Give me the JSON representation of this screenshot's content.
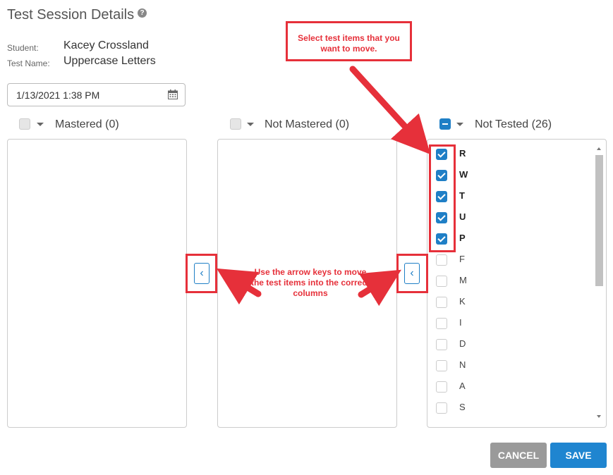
{
  "header": {
    "title": "Test Session Details",
    "help_icon": "?"
  },
  "student": {
    "label": "Student:",
    "value": "Kacey Crossland"
  },
  "test": {
    "label": "Test Name:",
    "value": "Uppercase Letters"
  },
  "date_field": {
    "value": "1/13/2021 1:38 PM",
    "icon": "calendar-icon"
  },
  "columns": {
    "mastered": {
      "title": "Mastered (0)"
    },
    "not_mastered": {
      "title": "Not Mastered (0)"
    },
    "not_tested": {
      "title": "Not Tested (26)"
    }
  },
  "items": [
    {
      "label": "R",
      "checked": true
    },
    {
      "label": "W",
      "checked": true
    },
    {
      "label": "T",
      "checked": true
    },
    {
      "label": "U",
      "checked": true
    },
    {
      "label": "P",
      "checked": true
    },
    {
      "label": "F",
      "checked": false
    },
    {
      "label": "M",
      "checked": false
    },
    {
      "label": "K",
      "checked": false
    },
    {
      "label": "I",
      "checked": false
    },
    {
      "label": "D",
      "checked": false
    },
    {
      "label": "N",
      "checked": false
    },
    {
      "label": "A",
      "checked": false
    },
    {
      "label": "S",
      "checked": false
    }
  ],
  "move_buttons": {
    "glyph": "‹"
  },
  "buttons": {
    "cancel": "CANCEL",
    "save": "SAVE"
  },
  "annotations": {
    "select_note": "Select test items that you want to move.",
    "arrow_note": "Use the arrow keys to move the test items into the correct columns"
  },
  "colors": {
    "accent": "#1f7fc6",
    "annotation": "#e6303a",
    "cancel": "#9a9a9a",
    "save": "#1f85d0"
  }
}
